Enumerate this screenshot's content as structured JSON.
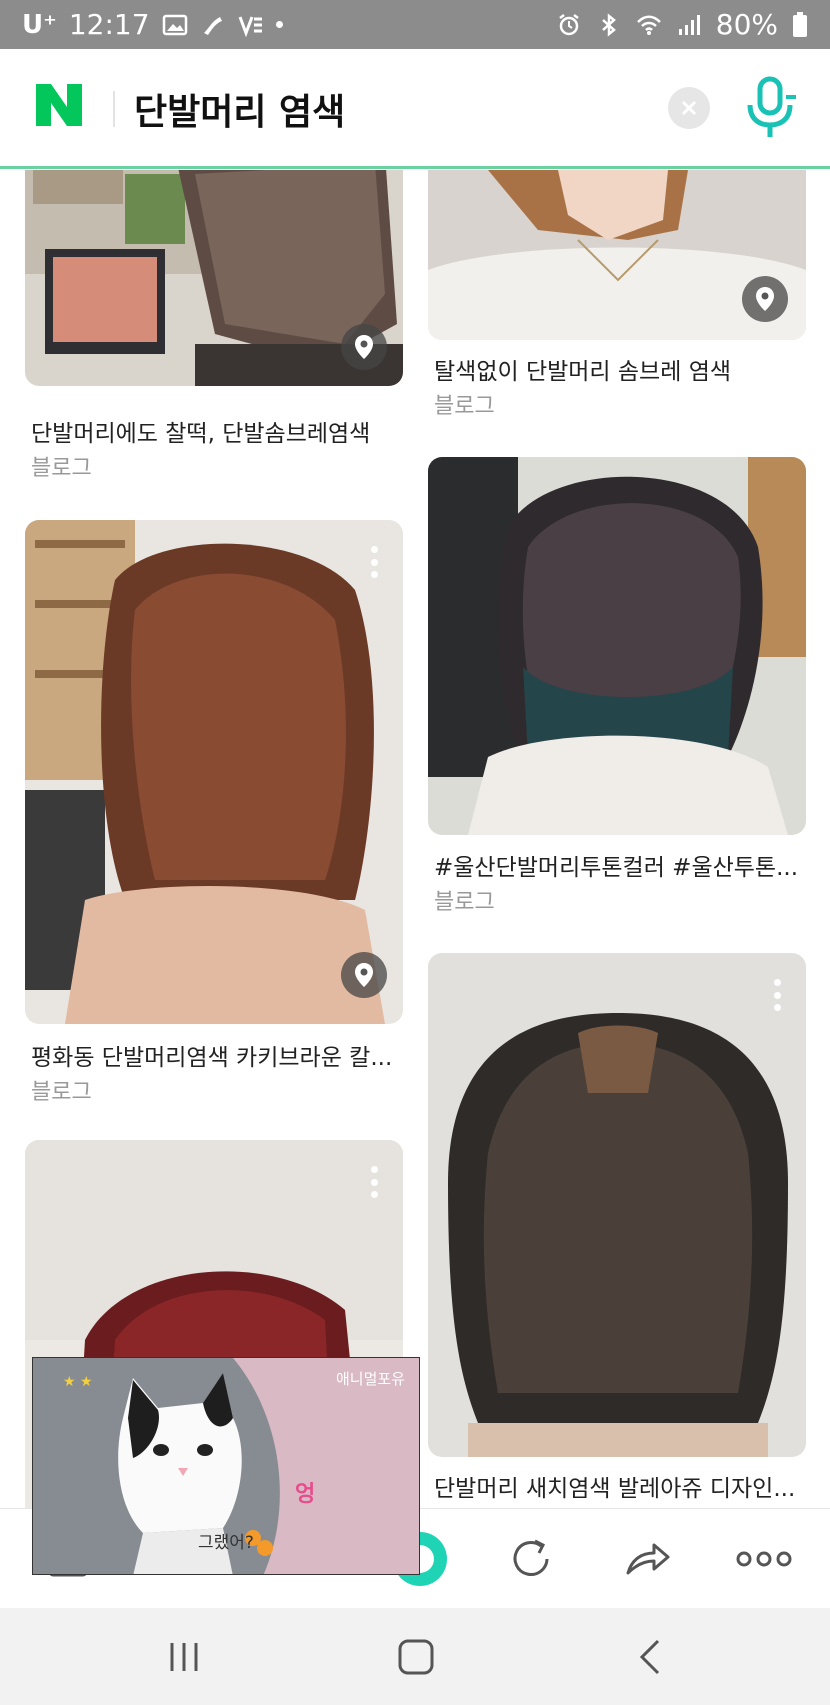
{
  "status_bar": {
    "carrier": "U⁺",
    "time": "12:17",
    "battery": "80%"
  },
  "search": {
    "query": "단발머리 염색",
    "logo_letter": "N",
    "accent_color": "#03c75a",
    "underline_color": "#6ad1a0"
  },
  "results": [
    {
      "title": "단발머리에도 찰떡, 단발솜브레염색",
      "source": "블로그",
      "badge": "location-pin-icon"
    },
    {
      "title": "탈색없이 단발머리 솜브레 염색",
      "source": "블로그",
      "badge": "location-pin-icon"
    },
    {
      "title": "평화동 단발머리염색 카키브라운 칼...",
      "source": "블로그",
      "badge": "location-pin-icon"
    },
    {
      "title": "#울산단발머리투톤컬러 #울산투톤...",
      "source": "블로그",
      "badge": "none"
    },
    {
      "title": "",
      "source": "",
      "badge": "more-icon"
    },
    {
      "title": "단발머리 새치염색 발레아쥬 디자인...",
      "source": "",
      "badge": "more-icon"
    }
  ],
  "pip_video": {
    "tag_right": "애니멀포유",
    "caption": "그랬어?",
    "bubble": "엉"
  },
  "toolbar": {
    "items": [
      "tabs-icon",
      "green-home-icon",
      "refresh-icon",
      "share-icon",
      "more-options-icon"
    ]
  },
  "nav": {
    "items": [
      "recent-apps-icon",
      "home-icon",
      "back-icon"
    ]
  }
}
